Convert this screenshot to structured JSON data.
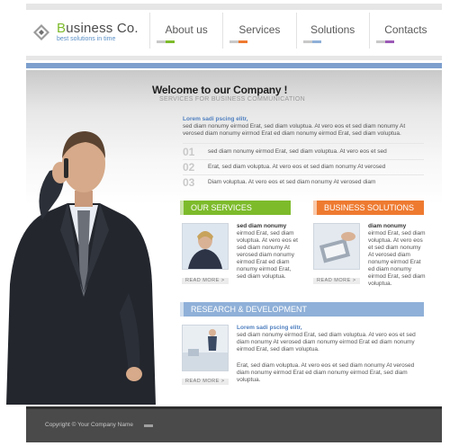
{
  "brand": {
    "name_first": "B",
    "name_rest": "usiness Co.",
    "tagline": "best solutions in time"
  },
  "nav": [
    {
      "label": "About us",
      "accent": "#7dbb2b"
    },
    {
      "label": "Services",
      "accent": "#ee7a30"
    },
    {
      "label": "Solutions",
      "accent": "#8fb0d8"
    },
    {
      "label": "Contacts",
      "accent": "#9b59b6"
    }
  ],
  "hero": {
    "title": "Welcome to our Company !",
    "subtitle": "SERVICES FOR BUSINESS COMMUNICATION"
  },
  "intro": {
    "title": "Lorem sadi pscing elitr,",
    "text": "sed diam nonumy eirmod Erat, sed diam voluptua. At vero eos et sed diam nonumy At verosed diam nonumy eirmod Erat ed diam nonumy eirmod Erat, sed diam voluptua."
  },
  "steps": [
    {
      "num": "01",
      "text": "sed diam nonumy eirmod Erat, sed diam voluptua. At vero eos et sed"
    },
    {
      "num": "02",
      "text": "Erat, sed diam voluptua. At vero eos et sed diam nonumy At verosed"
    },
    {
      "num": "03",
      "text": "Diam voluptua. At vero eos et sed diam nonumy At verosed diam"
    }
  ],
  "services": {
    "heading": "OUR SERVICES",
    "color": "#7dbb2b",
    "title": "sed diam nonumy",
    "text": "eirmod Erat, sed diam voluptua. At vero eos et sed diam nonumy At verosed diam nonumy eirmod Erat ed diam nonumy eirmod Erat, sed diam voluptua.",
    "more": "READ MORE >"
  },
  "solutions": {
    "heading": "BUSINESS SOLUTIONS",
    "color": "#ee7a30",
    "title": "diam nonumy",
    "text": "eirmod Erat, sed diam voluptua. At vero eos et sed diam nonumy At verosed diam nonumy eirmod Erat ed diam nonumy eirmod Erat, sed diam voluptua.",
    "more": "READ MORE >"
  },
  "research": {
    "heading": "RESEARCH & DEVELOPMENT",
    "color": "#8fb0d8",
    "title": "Lorem sadi pscing elitr,",
    "text1": "sed diam nonumy eirmod Erat, sed diam voluptua. At vero eos et sed diam nonumy At verosed diam nonumy eirmod Erat ed diam nonumy eirmod Erat, sed diam voluptua.",
    "text2": "Erat, sed diam voluptua. At vero eos et sed diam nonumy At verosed diam nonumy eirmod Erat ed diam nonumy eirmod Erat, sed diam voluptua.",
    "more": "READ MORE >"
  },
  "footer": {
    "copyright": "Copyright © Your Company Name"
  }
}
